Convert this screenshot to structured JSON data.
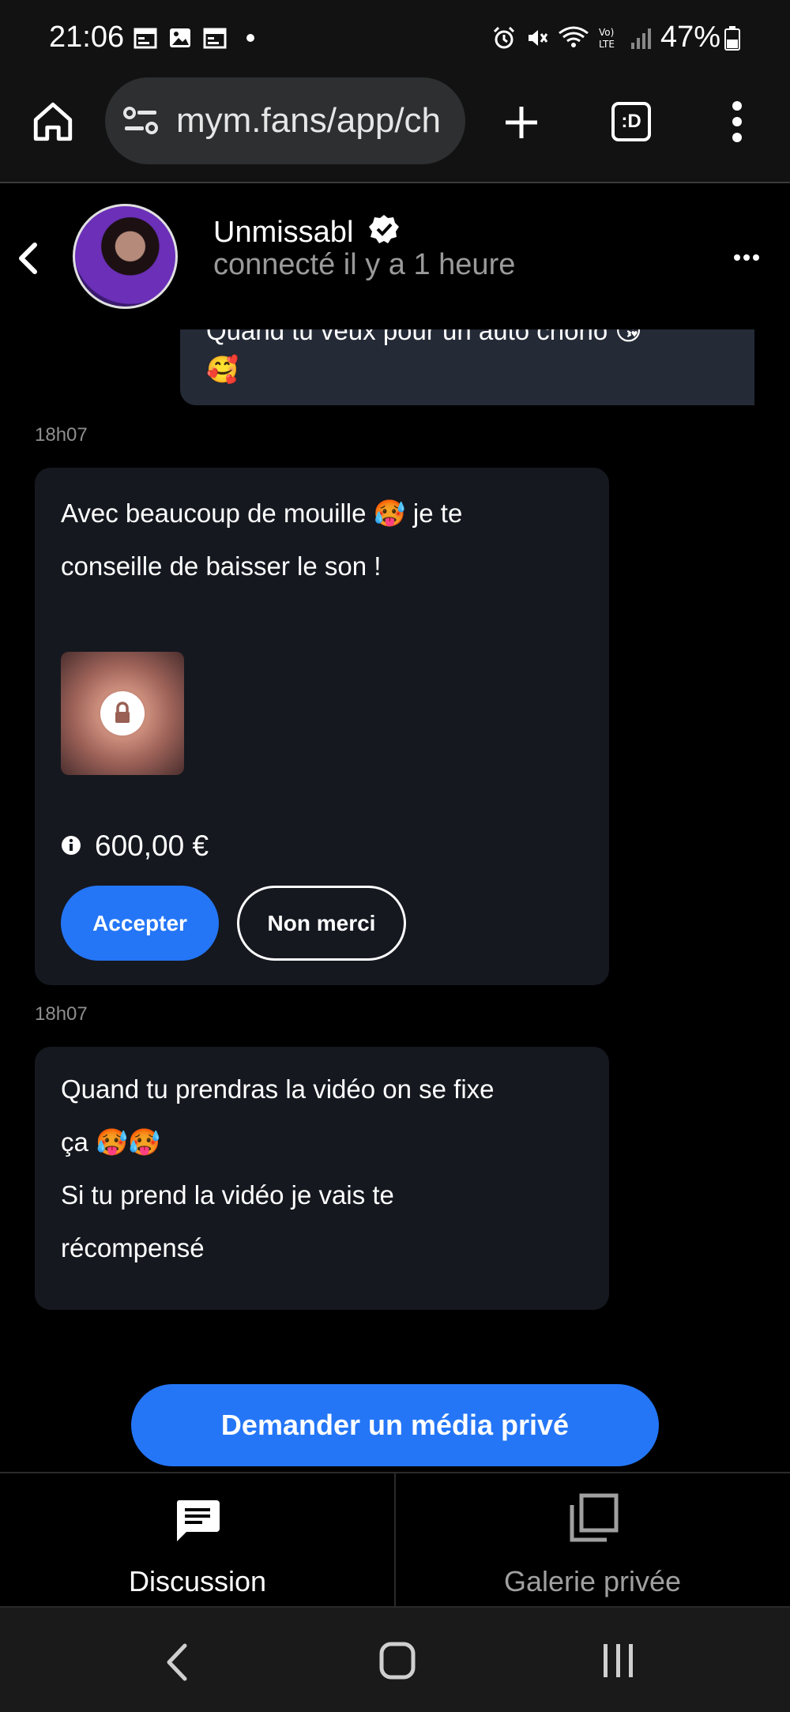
{
  "status_bar": {
    "time": "21:06",
    "battery_percent": "47%",
    "icons": [
      "calendar-icon",
      "image-icon",
      "calendar-icon",
      "dot-icon",
      "alarm-icon",
      "mute-icon",
      "wifi-icon",
      "volte-icon",
      "signal-icon",
      "battery-icon"
    ]
  },
  "browser": {
    "url": "mym.fans/app/ch",
    "icons": [
      "home-icon",
      "site-settings-icon",
      "new-tab-icon",
      "tab-switcher-icon",
      "more-vert-icon"
    ],
    "tab_switcher_label": ":D"
  },
  "chat_header": {
    "name": "Unmissabl",
    "status": "connecté il y a 1 heure"
  },
  "messages": {
    "partial_outgoing": {
      "line1": "Quand tu veux pour un auto choho 😘",
      "line2": "🥰"
    },
    "offer": {
      "time": "18h07",
      "line1": "Avec beaucoup de mouille 🥵 je te",
      "line2": "conseille de baisser le son !",
      "price": "600,00 €",
      "accept_label": "Accepter",
      "decline_label": "Non merci"
    },
    "second": {
      "time": "18h07",
      "line1": "Quand tu prendras la vidéo on se fixe",
      "line2": "ça 🥵🥵",
      "line3": "Si tu prend la vidéo je vais te",
      "line4": "récompensé"
    }
  },
  "request_media_label": "Demander un média privé",
  "tabs": {
    "discussion": "Discussion",
    "gallery": "Galerie privée"
  },
  "colors": {
    "accent": "#2476f6",
    "bubble": "#15181f",
    "outgoing_bubble": "#242a36"
  }
}
